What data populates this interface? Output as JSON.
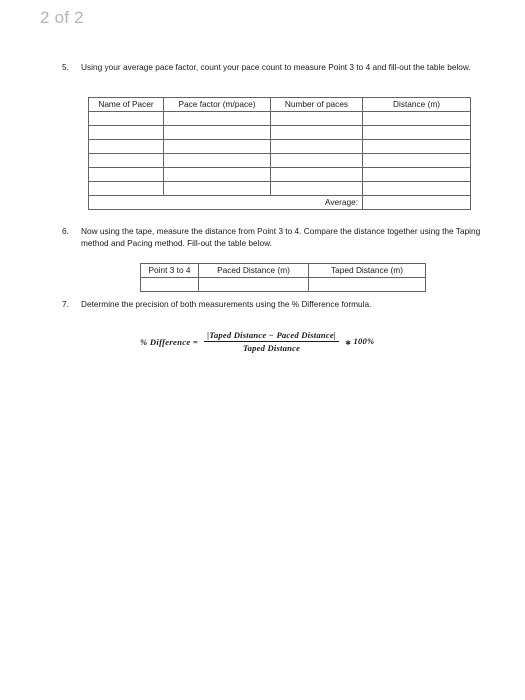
{
  "header": {
    "page_indicator": "2 of 2"
  },
  "items": [
    {
      "marker": "5.",
      "text": "Using your average pace factor, count your pace count to measure Point 3 to 4 and fill-out the table below."
    },
    {
      "marker": "6.",
      "text": "Now using the tape, measure the distance from Point 3 to 4. Compare the distance together using the Taping method and Pacing method. Fill-out the table below."
    },
    {
      "marker": "7.",
      "text": "Determine the precision of both measurements using the % Difference formula."
    }
  ],
  "pacer_table": {
    "headers": [
      "Name of Pacer",
      "Pace factor (m/pace)",
      "Number of paces",
      "Distance (m)"
    ],
    "rows": [
      [
        "",
        "",
        "",
        ""
      ],
      [
        "",
        "",
        "",
        ""
      ],
      [
        "",
        "",
        "",
        ""
      ],
      [
        "",
        "",
        "",
        ""
      ],
      [
        "",
        "",
        "",
        ""
      ],
      [
        "",
        "",
        "",
        ""
      ]
    ],
    "average_label": "Average:",
    "average_value": ""
  },
  "compare_table": {
    "headers": [
      "Point 3 to 4",
      "Paced Distance (m)",
      "Taped Distance (m)"
    ],
    "rows": [
      [
        "",
        "",
        ""
      ]
    ]
  },
  "formula": {
    "lhs": "% Difference =",
    "numerator": "|Taped Distance − Paced Distance|",
    "denominator": "Taped Distance",
    "operator": "∗",
    "tail": "100%"
  },
  "colors": {
    "page_background": "#ffffff",
    "text": "#1a1a1a",
    "muted": "#b3b3b3",
    "table_border": "#636363"
  }
}
